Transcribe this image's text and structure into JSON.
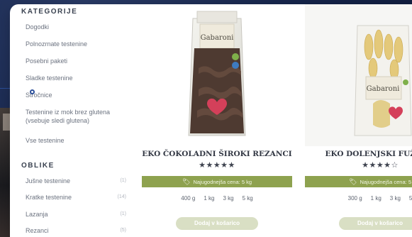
{
  "sidebar": {
    "categories_title": "KATEGORIJE",
    "categories": [
      "Dogodki",
      "Polnozrnate testenine",
      "Posebni paketi",
      "Sladke testenine",
      "Stročnice",
      "Testenine iz mok brez glutena (vsebuje sledi glutena)",
      "Vse testenine"
    ],
    "shapes_title": "OBLIKE",
    "shapes": [
      {
        "label": "Jušne testenine",
        "count": "(1)"
      },
      {
        "label": "Kratke testenine",
        "count": "(14)"
      },
      {
        "label": "Lazanja",
        "count": "(1)"
      },
      {
        "label": "Rezanci",
        "count": "(5)"
      }
    ]
  },
  "products": [
    {
      "name": "EKO ČOKOLADNI ŠIROKI REZANCI",
      "stars": "★★★★★",
      "lowest_price": "Najugodnejša cena: 5 kg",
      "weights": [
        "400 g",
        "1 kg",
        "3 kg",
        "5 kg"
      ],
      "add_label": "Dodaj v košarico",
      "brand": "Gabaroni"
    },
    {
      "name": "EKO DOLENJSKI FUŽIJI D",
      "stars": "★★★★☆",
      "lowest_price": "Najugodnejša cena: 5",
      "weights": [
        "300 g",
        "1 kg",
        "3 kg",
        "5"
      ],
      "add_label": "Dodaj v košarico",
      "brand": "Gabaroni"
    }
  ],
  "colors": {
    "price_bar": "#8ea24f",
    "button": "#d9dfc4",
    "background": "#16254a"
  }
}
